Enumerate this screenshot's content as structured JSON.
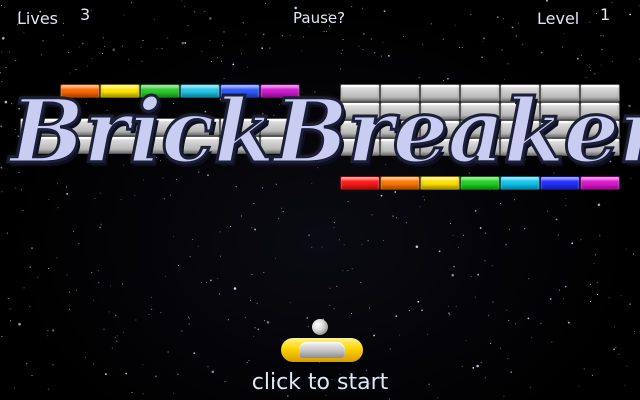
{
  "hud": {
    "lives_label": "Lives",
    "lives": "3",
    "pause_label": "Pause?",
    "level_label": "Level",
    "level": "1"
  },
  "title": "BrickBreaker!",
  "start_prompt": "click to start",
  "colors": {
    "paddle": "#ffd400",
    "title_fill": "#c9cdf2",
    "hud_text": "#dfe6f5",
    "background": "#000000"
  },
  "bricks": {
    "top_row_colors": [
      "#ff6a00",
      "#ffe600",
      "#2ecc2e",
      "#22c7e8",
      "#2f5bff",
      "#d21cd2"
    ],
    "bottom_row_colors": [
      "#ff1a1a",
      "#ff7a00",
      "#ffe000",
      "#22d322",
      "#12c6f0",
      "#2430ff",
      "#e01ad0"
    ],
    "grey_left_count": 14,
    "grey_right_count": 28
  }
}
